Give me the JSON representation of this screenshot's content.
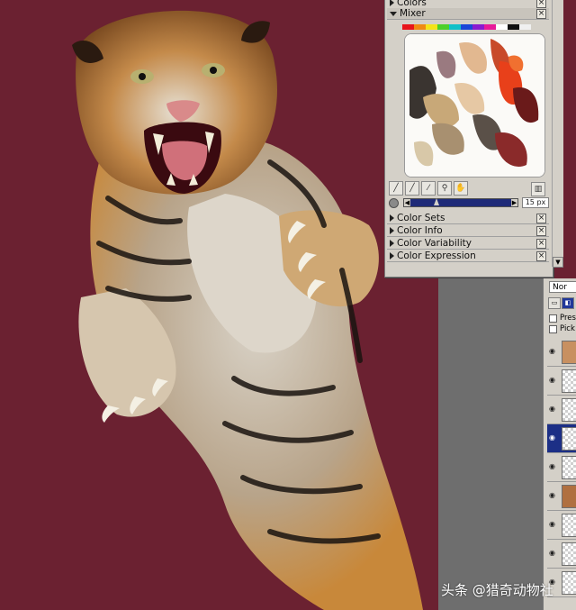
{
  "palette": {
    "sections_top": [
      {
        "label": "Colors",
        "expanded": false
      },
      {
        "label": "Mixer",
        "expanded": true
      }
    ],
    "swatch_colors": [
      "#e8141a",
      "#f08a12",
      "#f4e418",
      "#4cd02a",
      "#12c0c8",
      "#1a46d8",
      "#8a1ad0",
      "#e81a9a",
      "#ffffff",
      "#101010",
      "#f0f0f0"
    ],
    "mixer_tools": [
      "dirty-brush-icon",
      "clean-brush-icon",
      "dropper-icon",
      "zoom-icon",
      "pan-icon"
    ],
    "brush_size": "15 px",
    "brush_size_fraction": 0.26,
    "sections_bottom": [
      {
        "label": "Color Sets",
        "expanded": false
      },
      {
        "label": "Color Info",
        "expanded": false
      },
      {
        "label": "Color Variability",
        "expanded": false
      },
      {
        "label": "Color Expression",
        "expanded": false
      }
    ]
  },
  "layers": {
    "blend_mode": "Nor",
    "preserve_label": "Pres",
    "pick_label": "Pick"
  },
  "watermark": "头条 @猎奇动物社",
  "colors": {
    "canvas_bg": "#6b2131",
    "panel": "#d4d0c8",
    "selected_layer": "#1c2f86",
    "slider_track": "#1e2a78"
  }
}
